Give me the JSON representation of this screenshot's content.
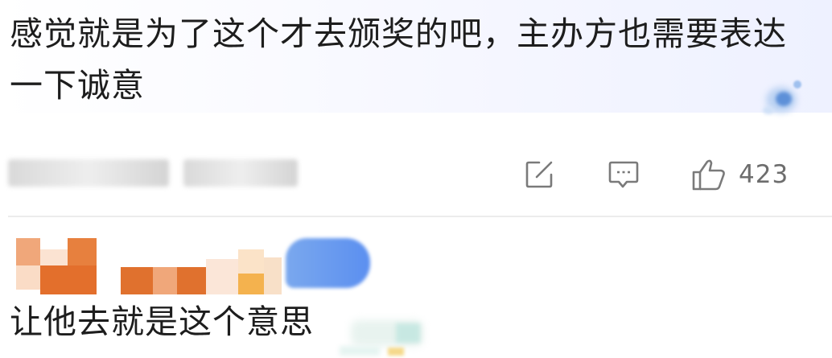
{
  "comment_1": {
    "text": "感觉就是为了这个才去颁奖的吧，主办方也需要表达一下诚意",
    "meta_blurred": true,
    "actions": {
      "share_icon": "share-icon",
      "reply_icon": "comment-icon",
      "like_icon": "thumbs-up-icon",
      "like_count": "423"
    }
  },
  "comment_2": {
    "username_blurred": true,
    "text": "让他去就是这个意思"
  },
  "colors": {
    "icon_gray": "#7a7a7a",
    "text": "#1d1d1d",
    "divider": "#ececec",
    "name_blur_blue": "#5b8ff0"
  }
}
